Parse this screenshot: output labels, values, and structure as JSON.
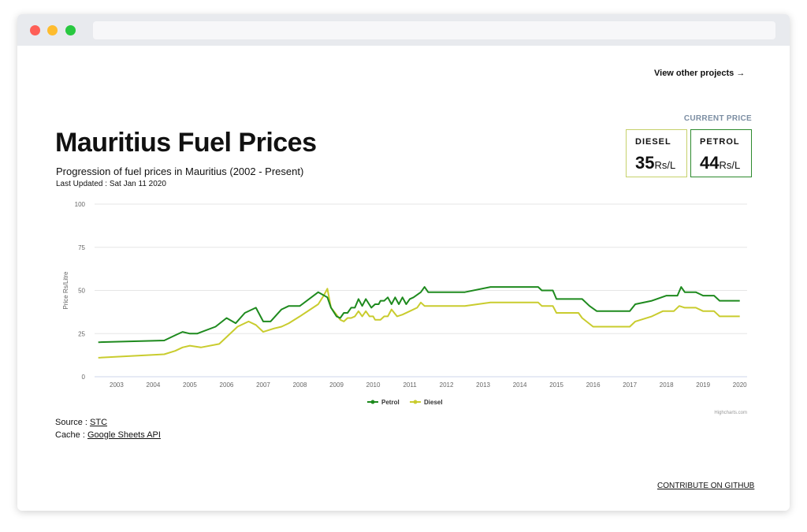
{
  "nav": {
    "view_other_label": "View other projects →"
  },
  "current_price": {
    "label": "CURRENT PRICE",
    "diesel": {
      "label": "DIESEL",
      "value": "35",
      "unit": "Rs/L"
    },
    "petrol": {
      "label": "PETROL",
      "value": "44",
      "unit": "Rs/L"
    }
  },
  "header": {
    "title": "Mauritius Fuel Prices",
    "subtitle": "Progression of fuel prices in Mauritius (2002 - Present)",
    "last_updated": "Last Updated : Sat Jan 11 2020"
  },
  "footer": {
    "source_prefix": "Source : ",
    "source_link": "STC",
    "cache_prefix": "Cache : ",
    "cache_link": "Google Sheets API",
    "github_link": "CONTRIBUTE ON GITHUB"
  },
  "colors": {
    "petrol": "#1e8a1e",
    "diesel": "#c9cc2e",
    "accent_label": "#7c8ea3"
  },
  "chart_data": {
    "type": "line",
    "ylabel": "Price Rs/Litre",
    "xlabel": "",
    "ylim": [
      0,
      100
    ],
    "yticks": [
      0,
      25,
      50,
      75,
      100
    ],
    "xlim": [
      2002.4,
      2020.2
    ],
    "xticks": [
      2003,
      2004,
      2005,
      2006,
      2007,
      2008,
      2009,
      2010,
      2011,
      2012,
      2013,
      2014,
      2015,
      2016,
      2017,
      2018,
      2019,
      2020
    ],
    "legend": "bottom-center",
    "credit": "Highcharts.com",
    "series": [
      {
        "name": "Petrol",
        "color": "#1e8a1e",
        "points": [
          [
            2002.5,
            20
          ],
          [
            2004.3,
            21
          ],
          [
            2004.6,
            24
          ],
          [
            2004.8,
            26
          ],
          [
            2005.0,
            25
          ],
          [
            2005.2,
            25
          ],
          [
            2005.7,
            29
          ],
          [
            2006.0,
            34
          ],
          [
            2006.25,
            31
          ],
          [
            2006.5,
            37
          ],
          [
            2006.8,
            40
          ],
          [
            2007.0,
            32
          ],
          [
            2007.2,
            32
          ],
          [
            2007.5,
            39
          ],
          [
            2007.7,
            41
          ],
          [
            2008.0,
            41
          ],
          [
            2008.5,
            49
          ],
          [
            2008.75,
            46
          ],
          [
            2008.85,
            40
          ],
          [
            2009.0,
            35
          ],
          [
            2009.1,
            34
          ],
          [
            2009.2,
            37
          ],
          [
            2009.3,
            37
          ],
          [
            2009.4,
            40
          ],
          [
            2009.5,
            40
          ],
          [
            2009.6,
            45
          ],
          [
            2009.7,
            41
          ],
          [
            2009.8,
            45
          ],
          [
            2009.95,
            40
          ],
          [
            2010.05,
            42
          ],
          [
            2010.15,
            42
          ],
          [
            2010.2,
            44
          ],
          [
            2010.3,
            44
          ],
          [
            2010.4,
            46
          ],
          [
            2010.5,
            42
          ],
          [
            2010.6,
            46
          ],
          [
            2010.7,
            42
          ],
          [
            2010.8,
            46
          ],
          [
            2010.9,
            42
          ],
          [
            2011.0,
            45
          ],
          [
            2011.1,
            46
          ],
          [
            2011.3,
            49
          ],
          [
            2011.4,
            52
          ],
          [
            2011.5,
            49
          ],
          [
            2012.0,
            49
          ],
          [
            2012.5,
            49
          ],
          [
            2013.2,
            52
          ],
          [
            2014.5,
            52
          ],
          [
            2014.6,
            50
          ],
          [
            2014.9,
            50
          ],
          [
            2015.0,
            45
          ],
          [
            2015.7,
            45
          ],
          [
            2015.9,
            41
          ],
          [
            2016.1,
            38
          ],
          [
            2017.0,
            38
          ],
          [
            2017.15,
            42
          ],
          [
            2017.6,
            44
          ],
          [
            2018.0,
            47
          ],
          [
            2018.3,
            47
          ],
          [
            2018.4,
            52
          ],
          [
            2018.5,
            49
          ],
          [
            2018.8,
            49
          ],
          [
            2019.0,
            47
          ],
          [
            2019.3,
            47
          ],
          [
            2019.45,
            44
          ],
          [
            2020.0,
            44
          ]
        ]
      },
      {
        "name": "Diesel",
        "color": "#c9cc2e",
        "points": [
          [
            2002.5,
            11
          ],
          [
            2004.3,
            13
          ],
          [
            2004.6,
            15
          ],
          [
            2004.8,
            17
          ],
          [
            2005.0,
            18
          ],
          [
            2005.3,
            17
          ],
          [
            2005.8,
            19
          ],
          [
            2006.0,
            23
          ],
          [
            2006.3,
            29
          ],
          [
            2006.6,
            32
          ],
          [
            2006.8,
            30
          ],
          [
            2007.0,
            26
          ],
          [
            2007.3,
            28
          ],
          [
            2007.5,
            29
          ],
          [
            2007.7,
            31
          ],
          [
            2008.0,
            35
          ],
          [
            2008.5,
            42
          ],
          [
            2008.65,
            47
          ],
          [
            2008.75,
            51
          ],
          [
            2008.85,
            40
          ],
          [
            2009.0,
            36
          ],
          [
            2009.1,
            33
          ],
          [
            2009.2,
            32
          ],
          [
            2009.3,
            34
          ],
          [
            2009.4,
            34
          ],
          [
            2009.5,
            35
          ],
          [
            2009.6,
            38
          ],
          [
            2009.7,
            35
          ],
          [
            2009.8,
            38
          ],
          [
            2009.9,
            35
          ],
          [
            2010.0,
            35
          ],
          [
            2010.05,
            33
          ],
          [
            2010.2,
            33
          ],
          [
            2010.3,
            35
          ],
          [
            2010.4,
            35
          ],
          [
            2010.5,
            39
          ],
          [
            2010.65,
            35
          ],
          [
            2010.8,
            36
          ],
          [
            2011.0,
            38
          ],
          [
            2011.2,
            40
          ],
          [
            2011.3,
            43
          ],
          [
            2011.4,
            41
          ],
          [
            2012.5,
            41
          ],
          [
            2013.2,
            43
          ],
          [
            2014.5,
            43
          ],
          [
            2014.6,
            41
          ],
          [
            2014.9,
            41
          ],
          [
            2015.0,
            37
          ],
          [
            2015.6,
            37
          ],
          [
            2015.7,
            34
          ],
          [
            2016.0,
            29
          ],
          [
            2017.0,
            29
          ],
          [
            2017.15,
            32
          ],
          [
            2017.6,
            35
          ],
          [
            2017.9,
            38
          ],
          [
            2018.2,
            38
          ],
          [
            2018.35,
            41
          ],
          [
            2018.5,
            40
          ],
          [
            2018.8,
            40
          ],
          [
            2019.0,
            38
          ],
          [
            2019.3,
            38
          ],
          [
            2019.45,
            35
          ],
          [
            2020.0,
            35
          ]
        ]
      }
    ]
  }
}
